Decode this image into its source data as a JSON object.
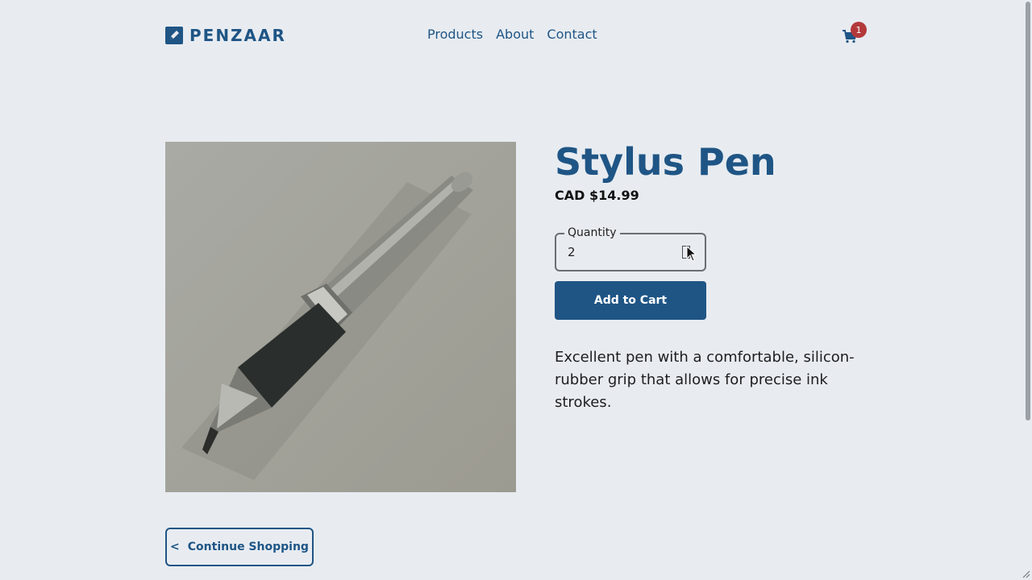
{
  "brand": {
    "name": "PENZAAR",
    "color": "#1f5585"
  },
  "nav": {
    "items": [
      "Products",
      "About",
      "Contact"
    ]
  },
  "cart": {
    "count": "1",
    "badge_color": "#b3393b",
    "icon": "cart-icon"
  },
  "product": {
    "title": "Stylus Pen",
    "price": "CAD $14.99",
    "quantity_label": "Quantity",
    "quantity_value": "2",
    "add_to_cart_label": "Add to Cart",
    "description": "Excellent pen with a comfortable, silicon-rubber grip that allows for precise ink strokes.",
    "image_icon": "pen-photo"
  },
  "actions": {
    "continue_label": "Continue Shopping",
    "continue_icon": "chevron-left-icon"
  }
}
